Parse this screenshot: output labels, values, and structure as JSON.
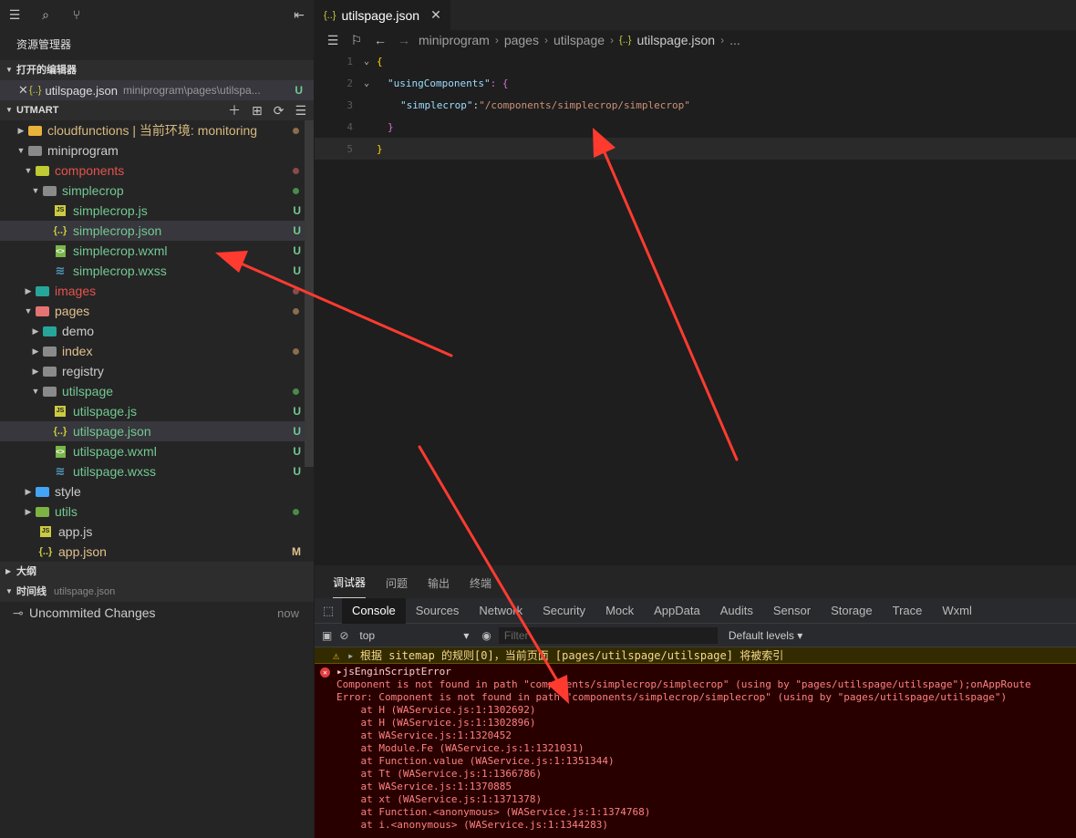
{
  "sidebar": {
    "explorer_title": "资源管理器",
    "open_editors_label": "打开的编辑器",
    "open_editor": {
      "name": "utilspage.json",
      "path": "miniprogram\\pages\\utilspa...",
      "status": "U"
    },
    "project_label": "UTMART",
    "tree": [
      {
        "label": "cloudfunctions | 当前环境: monitoring",
        "status": "",
        "dot": "#8a6d4a"
      },
      {
        "label": "miniprogram",
        "status": "",
        "dot": ""
      },
      {
        "label": "components",
        "status": "",
        "dot": "#8a4a4a"
      },
      {
        "label": "simplecrop",
        "status": "",
        "dot": "#4a8a4a"
      },
      {
        "label": "simplecrop.js",
        "status": "U"
      },
      {
        "label": "simplecrop.json",
        "status": "U"
      },
      {
        "label": "simplecrop.wxml",
        "status": "U"
      },
      {
        "label": "simplecrop.wxss",
        "status": "U"
      },
      {
        "label": "images",
        "status": "",
        "dot": "#8a4a4a"
      },
      {
        "label": "pages",
        "status": "",
        "dot": "#8a6d4a"
      },
      {
        "label": "demo",
        "status": ""
      },
      {
        "label": "index",
        "status": "",
        "dot": "#8a6d4a"
      },
      {
        "label": "registry",
        "status": ""
      },
      {
        "label": "utilspage",
        "status": "",
        "dot": "#4a8a4a"
      },
      {
        "label": "utilspage.js",
        "status": "U"
      },
      {
        "label": "utilspage.json",
        "status": "U"
      },
      {
        "label": "utilspage.wxml",
        "status": "U"
      },
      {
        "label": "utilspage.wxss",
        "status": "U"
      },
      {
        "label": "style",
        "status": ""
      },
      {
        "label": "utils",
        "status": "",
        "dot": "#4a8a4a"
      },
      {
        "label": "app.js",
        "status": ""
      },
      {
        "label": "app.json",
        "status": "M"
      }
    ],
    "outline_label": "大纲",
    "timeline_label": "时间线",
    "timeline_file": "utilspage.json",
    "timeline_item": {
      "label": "Uncommited Changes",
      "when": "now"
    }
  },
  "editor": {
    "tab_label": "utilspage.json",
    "breadcrumb": [
      "miniprogram",
      "pages",
      "utilspage",
      "utilspage.json",
      "..."
    ],
    "lines": [
      {
        "n": "1",
        "text": "{"
      },
      {
        "n": "2",
        "key": "\"usingComponents\"",
        "rest": ": {"
      },
      {
        "n": "3",
        "key": "\"simplecrop\"",
        "colon": ":",
        "val": "\"/components/simplecrop/simplecrop\""
      },
      {
        "n": "4",
        "text": "}"
      },
      {
        "n": "5",
        "text": "}"
      }
    ]
  },
  "devtools": {
    "top_tabs": [
      "调试器",
      "问题",
      "输出",
      "终端"
    ],
    "panel_tabs": [
      "Console",
      "Sources",
      "Network",
      "Security",
      "Mock",
      "AppData",
      "Audits",
      "Sensor",
      "Storage",
      "Trace",
      "Wxml"
    ],
    "context": "top",
    "filter_placeholder": "Filter",
    "levels": "Default levels",
    "warning": "根据 sitemap 的规则[0]，当前页面 [pages/utilspage/utilspage] 将被索引",
    "error_title": "jsEnginScriptError",
    "error_lines": [
      "Component is not found in path \"components/simplecrop/simplecrop\" (using by \"pages/utilspage/utilspage\");onAppRoute",
      "Error: Component is not found in path \"components/simplecrop/simplecrop\" (using by \"pages/utilspage/utilspage\")",
      "    at H (WAService.js:1:1302692)",
      "    at H (WAService.js:1:1302896)",
      "    at WAService.js:1:1320452",
      "    at Module.Fe (WAService.js:1:1321031)",
      "    at Function.value (WAService.js:1:1351344)",
      "    at Tt (WAService.js:1:1366786)",
      "    at WAService.js:1:1370885",
      "    at xt (WAService.js:1:1371378)",
      "    at Function.<anonymous> (WAService.js:1:1374768)",
      "    at i.<anonymous> (WAService.js:1:1344283)"
    ]
  },
  "colors": {
    "arrow": "#ff3b30",
    "accent_green": "#73c991",
    "error_bg": "#290000"
  }
}
